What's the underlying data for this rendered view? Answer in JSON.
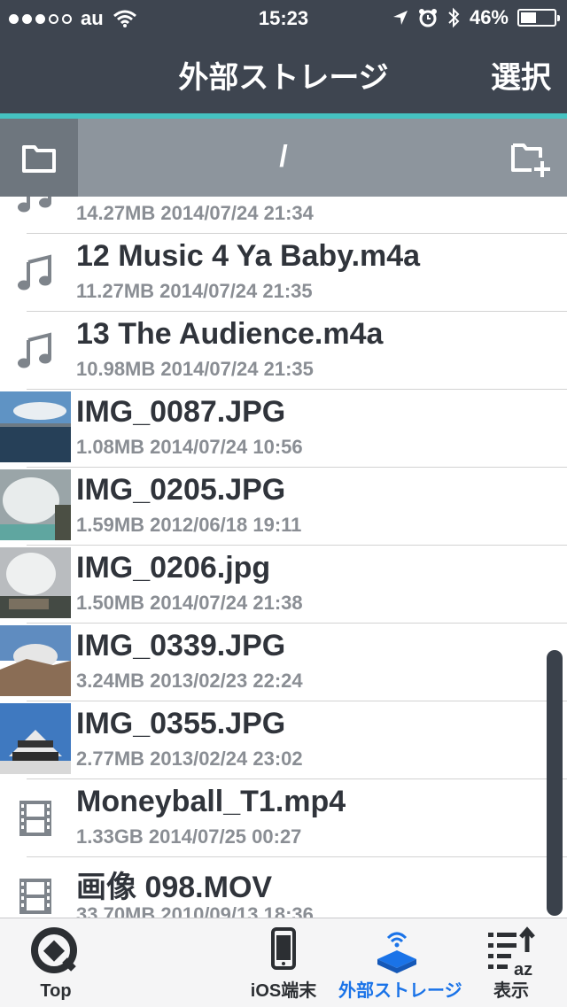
{
  "status": {
    "carrier": "au",
    "time": "15:23",
    "battery": "46%",
    "battery_level": 0.46
  },
  "nav": {
    "title": "外部ストレージ",
    "action": "選択"
  },
  "pathbar": {
    "path": "/"
  },
  "files": [
    {
      "name": "",
      "meta": "14.27MB 2014/07/24 21:34",
      "type": "music"
    },
    {
      "name": "12 Music 4 Ya Baby.m4a",
      "meta": "11.27MB 2014/07/24 21:35",
      "type": "music"
    },
    {
      "name": "13 The Audience.m4a",
      "meta": "10.98MB 2014/07/24 21:35",
      "type": "music"
    },
    {
      "name": "IMG_0087.JPG",
      "meta": "1.08MB 2014/07/24 10:56",
      "type": "image"
    },
    {
      "name": "IMG_0205.JPG",
      "meta": "1.59MB 2012/06/18 19:11",
      "type": "image"
    },
    {
      "name": "IMG_0206.jpg",
      "meta": "1.50MB 2014/07/24 21:38",
      "type": "image"
    },
    {
      "name": "IMG_0339.JPG",
      "meta": "3.24MB 2013/02/23 22:24",
      "type": "image"
    },
    {
      "name": "IMG_0355.JPG",
      "meta": "2.77MB 2013/02/24 23:02",
      "type": "image"
    },
    {
      "name": "Moneyball_T1.mp4",
      "meta": "1.33GB 2014/07/25 00:27",
      "type": "video"
    },
    {
      "name": "画像 098.MOV",
      "meta": "33.70MB 2010/09/13 18:36",
      "type": "video"
    }
  ],
  "tabs": [
    {
      "label": "Top",
      "icon": "qfinder-logo-icon",
      "active": false
    },
    {
      "label": "iOS端末",
      "icon": "phone-icon",
      "active": false
    },
    {
      "label": "外部ストレージ",
      "icon": "wireless-storage-icon",
      "active": true
    },
    {
      "label": "表示",
      "icon": "sort-list-icon",
      "active": false
    }
  ],
  "colors": {
    "nav": "#3e4550",
    "accent": "#45c2c1",
    "pathbar": "#8d959d",
    "active_tab": "#1a73e8"
  }
}
